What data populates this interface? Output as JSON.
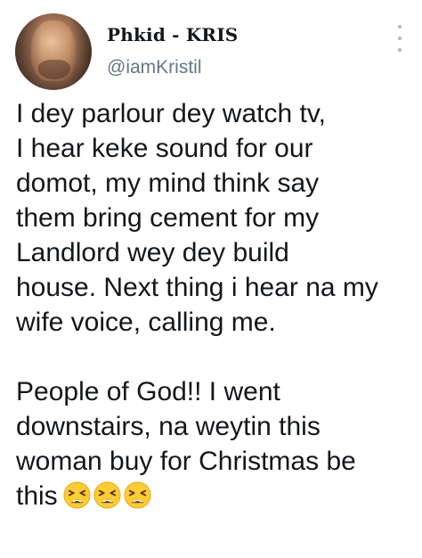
{
  "author": {
    "display_name": "Phkid - KRIS",
    "handle": "@iamKristil",
    "avatar_icon": "profile-photo-avatar"
  },
  "menu": {
    "icon": "more-vertical-icon"
  },
  "tweet": {
    "lines": [
      "I dey parlour dey watch tv,",
      "I hear keke sound for our",
      "domot, my mind think say",
      "them bring cement for my",
      "Landlord wey dey build",
      "house. Next thing i hear na my",
      "wife voice, calling me."
    ],
    "lines_2": [
      "People of God!! I went",
      "downstairs, na weytin this",
      "woman buy for Christmas be",
      "this"
    ],
    "emojis": [
      "tired-face-emoji",
      "tired-face-emoji",
      "tired-face-emoji"
    ]
  },
  "colors": {
    "text": "#14171a",
    "secondary": "#657786",
    "emoji_yellow": "#ffcc33"
  }
}
